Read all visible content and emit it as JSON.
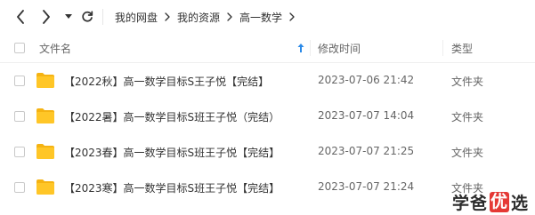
{
  "toolbar": {
    "back_icon": "chevron-left-icon",
    "forward_icon": "chevron-right-icon",
    "history_icon": "caret-down-icon",
    "refresh_icon": "refresh-icon",
    "breadcrumb": [
      "我的网盘",
      "我的资源",
      "高一数学"
    ]
  },
  "table": {
    "columns": {
      "name": "文件名",
      "modified": "修改时间",
      "type": "类型"
    },
    "sort_icon": "arrow-up-icon",
    "sort_color": "#2b8ae8",
    "rows": [
      {
        "name": "【2022秋】高一数学目标S王子悦【完结】",
        "modified": "2023-07-06 21:42",
        "type": "文件夹",
        "icon": "folder-icon"
      },
      {
        "name": "【2022暑】高一数学目标S班王子悦（完结）",
        "modified": "2023-07-07 14:04",
        "type": "文件夹",
        "icon": "folder-icon"
      },
      {
        "name": "【2023春】高一数学目标S班王子悦【完结】",
        "modified": "2023-07-07 21:25",
        "type": "文件夹",
        "icon": "folder-icon"
      },
      {
        "name": "【2023寒】高一数学目标S班王子悦【完结】",
        "modified": "2023-07-07 21:24",
        "type": "文件夹",
        "icon": "folder-icon"
      }
    ]
  },
  "colors": {
    "folder": "#ffc627",
    "folder_tab": "#f5b312",
    "watermark_badge": "#e53935"
  },
  "watermark": {
    "part1": "学爸",
    "badge": "优",
    "part2": "选"
  }
}
